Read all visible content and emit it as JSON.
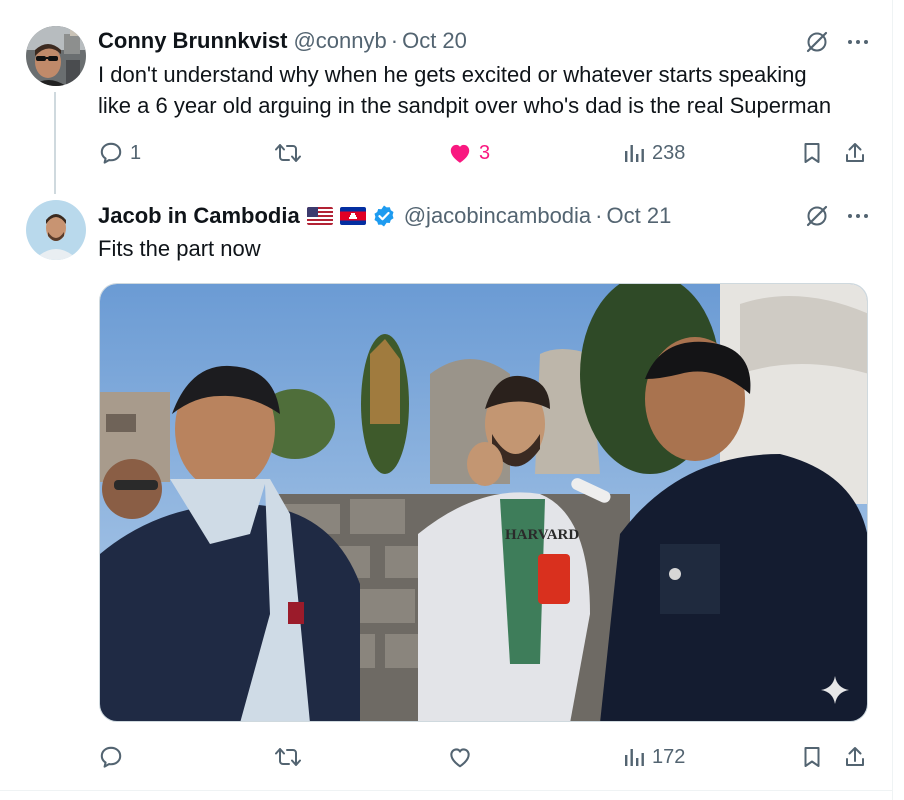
{
  "reply": {
    "author_name": "Conny Brunnkvist",
    "handle": "@connyb",
    "separator": "·",
    "date": "Oct 20",
    "text_line1": "I don't understand why when he gets excited or whatever starts speaking",
    "text_line2": "like a 6 year old arguing in the sandpit over who's dad is the real Superman",
    "counts": {
      "replies": "1",
      "reposts": "",
      "likes": "3",
      "views": "238"
    },
    "liked": true
  },
  "quote": {
    "author_name": "Jacob in Cambodia",
    "flags": [
      "us-flag",
      "cambodia-flag"
    ],
    "verified": true,
    "handle": "@jacobincambodia",
    "separator": "·",
    "date": "Oct 21",
    "text": "Fits the part now",
    "media_label": "HARVARD",
    "counts": {
      "replies": "",
      "reposts": "",
      "likes": "",
      "views": "172"
    }
  },
  "icons": {
    "grok": "grok-icon",
    "more": "more-options-icon",
    "reply": "reply-icon",
    "repost": "repost-icon",
    "like": "heart-icon",
    "views": "views-icon",
    "bookmark": "bookmark-icon",
    "share": "share-icon",
    "sparkle": "sparkle-icon"
  },
  "colors": {
    "like_pink": "#f91880",
    "verified_blue": "#1d9bf0",
    "muted_text": "#536471",
    "primary_text": "#0f1419"
  }
}
